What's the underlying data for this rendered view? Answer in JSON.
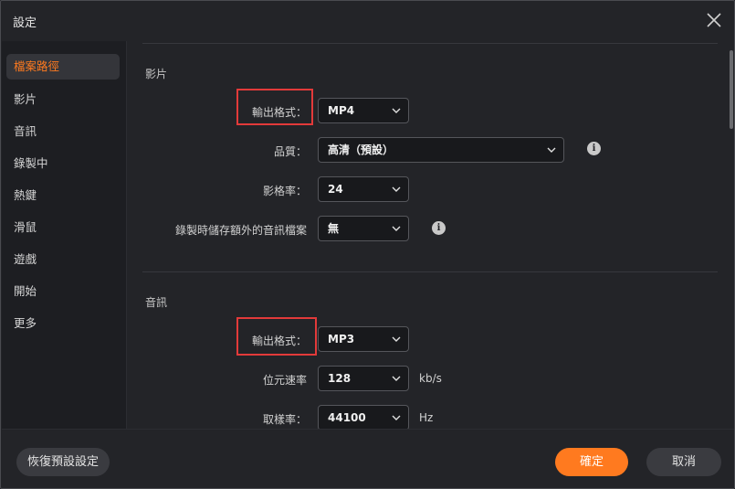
{
  "window": {
    "title": "設定",
    "close_icon": "close-icon"
  },
  "sidebar": {
    "items": [
      {
        "label": "檔案路徑",
        "active": true
      },
      {
        "label": "影片"
      },
      {
        "label": "音訊"
      },
      {
        "label": "錄製中"
      },
      {
        "label": "熱鍵"
      },
      {
        "label": "滑鼠"
      },
      {
        "label": "遊戲"
      },
      {
        "label": "開始"
      },
      {
        "label": "更多"
      }
    ]
  },
  "video": {
    "section_title": "影片",
    "output_format": {
      "label": "輸出格式：",
      "value": "MP4"
    },
    "quality": {
      "label": "品質：",
      "value": "高清（預設）",
      "info_icon": "info-icon"
    },
    "frame_rate": {
      "label": "影格率：",
      "value": "24"
    },
    "extra_audio": {
      "label": "錄製時儲存額外的音訊檔案",
      "value": "無",
      "info_icon": "info-icon"
    }
  },
  "audio": {
    "section_title": "音訊",
    "output_format": {
      "label": "輸出格式：",
      "value": "MP3"
    },
    "bitrate": {
      "label": "位元速率",
      "value": "128",
      "unit": "kb/s"
    },
    "sample_rate": {
      "label": "取樣率：",
      "value": "44100",
      "unit": "Hz"
    }
  },
  "footer": {
    "reset_label": "恢復預設設定",
    "ok_label": "確定",
    "cancel_label": "取消"
  },
  "colors": {
    "accent": "#ff7a1f",
    "highlight_box": "#e23a3a",
    "background": "#232428"
  }
}
